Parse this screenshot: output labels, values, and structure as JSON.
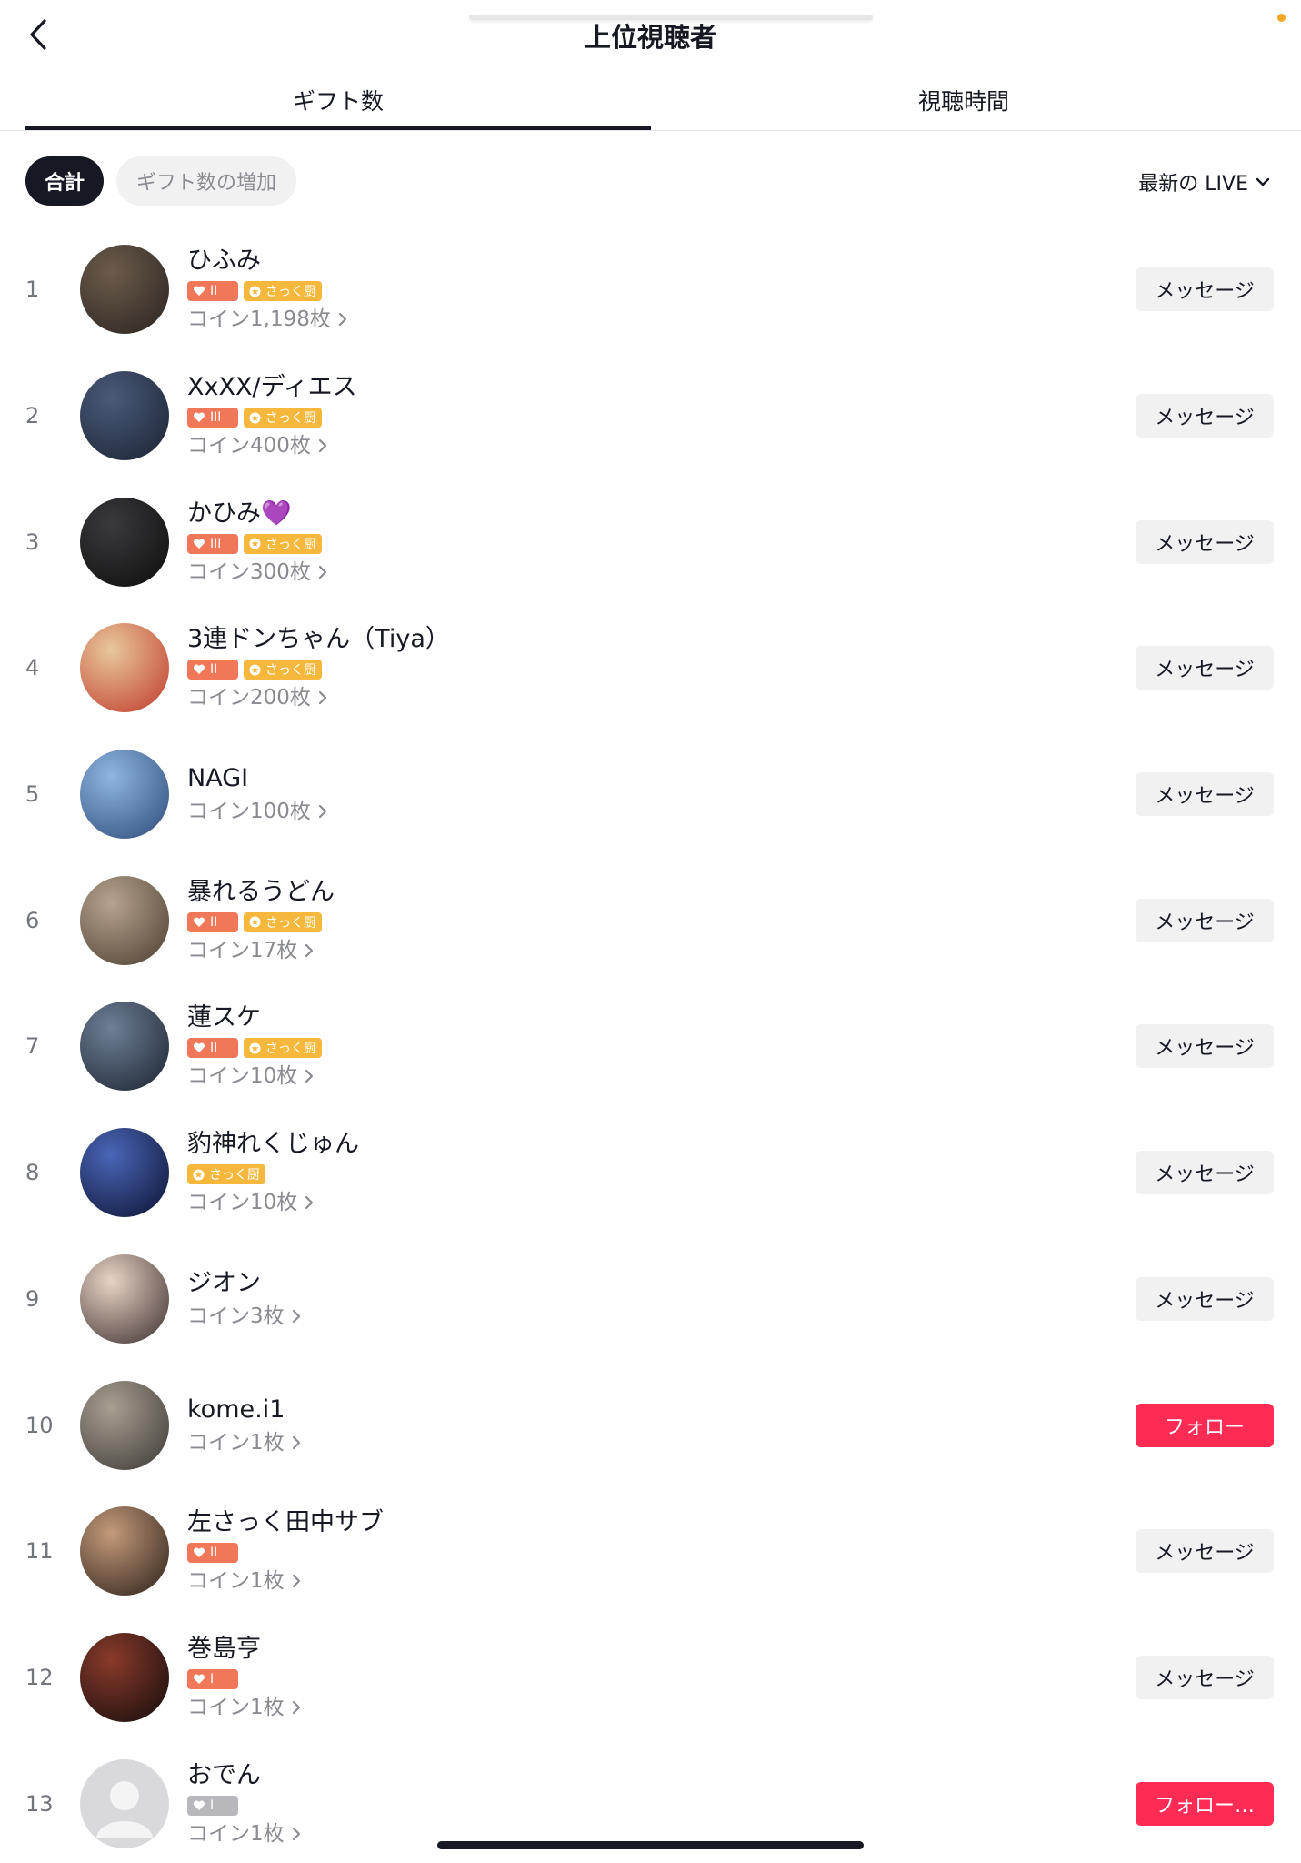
{
  "header": {
    "title": "上位視聴者"
  },
  "tabs": [
    {
      "label": "ギフト数",
      "active": true
    },
    {
      "label": "視聴時間",
      "active": false
    }
  ],
  "filters": {
    "chips": [
      {
        "label": "合計",
        "active": true
      },
      {
        "label": "ギフト数の増加",
        "active": false
      }
    ],
    "live_select": "最新の LIVE"
  },
  "viewers": [
    {
      "rank": "1",
      "name": "ひふみ",
      "fan_level": "II",
      "club_badge": "さっく厨",
      "coins": "コイン1,198枚",
      "action": "メッセージ",
      "avatar_colors": [
        "#6b5b4b",
        "#2a2320"
      ]
    },
    {
      "rank": "2",
      "name": "XxXX/ディエス",
      "fan_level": "III",
      "club_badge": "さっく厨",
      "coins": "コイン400枚",
      "action": "メッセージ",
      "avatar_colors": [
        "#4a5a78",
        "#1b2233"
      ]
    },
    {
      "rank": "3",
      "name": "かひみ💜",
      "fan_level": "III",
      "club_badge": "さっく厨",
      "coins": "コイン300枚",
      "action": "メッセージ",
      "avatar_colors": [
        "#3a3a3c",
        "#0d0d0e"
      ]
    },
    {
      "rank": "4",
      "name": "3連ドンちゃん（Tiya）",
      "fan_level": "II",
      "club_badge": "さっく厨",
      "coins": "コイン200枚",
      "action": "メッセージ",
      "avatar_colors": [
        "#e8c89a",
        "#c0392b"
      ]
    },
    {
      "rank": "5",
      "name": "NAGI",
      "fan_level": "",
      "club_badge": "",
      "coins": "コイン100枚",
      "action": "メッセージ",
      "avatar_colors": [
        "#8fb6e0",
        "#2d4a7a"
      ]
    },
    {
      "rank": "6",
      "name": "暴れるうどん",
      "fan_level": "II",
      "club_badge": "さっく厨",
      "coins": "コイン17枚",
      "action": "メッセージ",
      "avatar_colors": [
        "#b7a48e",
        "#4b3d30"
      ]
    },
    {
      "rank": "7",
      "name": "蓮スケ",
      "fan_level": "II",
      "club_badge": "さっく厨",
      "coins": "コイン10枚",
      "action": "メッセージ",
      "avatar_colors": [
        "#6f7f96",
        "#1a2230"
      ]
    },
    {
      "rank": "8",
      "name": "豹神れくじゅん",
      "fan_level": "",
      "club_badge": "さっく厨",
      "coins": "コイン10枚",
      "action": "メッセージ",
      "avatar_colors": [
        "#4a66b8",
        "#0b1230"
      ]
    },
    {
      "rank": "9",
      "name": "ジオン",
      "fan_level": "",
      "club_badge": "",
      "coins": "コイン3枚",
      "action": "メッセージ",
      "avatar_colors": [
        "#e9d3c6",
        "#3a2e2c"
      ]
    },
    {
      "rank": "10",
      "name": "kome.i1",
      "fan_level": "",
      "club_badge": "",
      "coins": "コイン1枚",
      "action": "フォロー",
      "avatar_colors": [
        "#a89f92",
        "#3b3833"
      ]
    },
    {
      "rank": "11",
      "name": "左さっく田中サブ",
      "fan_level": "II",
      "club_badge": "",
      "coins": "コイン1枚",
      "action": "メッセージ",
      "avatar_colors": [
        "#c49a7a",
        "#2b2019"
      ]
    },
    {
      "rank": "12",
      "name": "巻島亨",
      "fan_level": "I",
      "club_badge": "",
      "coins": "コイン1枚",
      "action": "メッセージ",
      "avatar_colors": [
        "#8a3a2a",
        "#120c0c"
      ]
    },
    {
      "rank": "13",
      "name": "おでん",
      "fan_level": "I",
      "fan_grey": true,
      "club_badge": "",
      "coins": "コイン1枚",
      "action": "フォロー…",
      "avatar_colors": [
        "#d7d7da",
        "#bfbfc3"
      ],
      "default_avatar": true
    }
  ]
}
